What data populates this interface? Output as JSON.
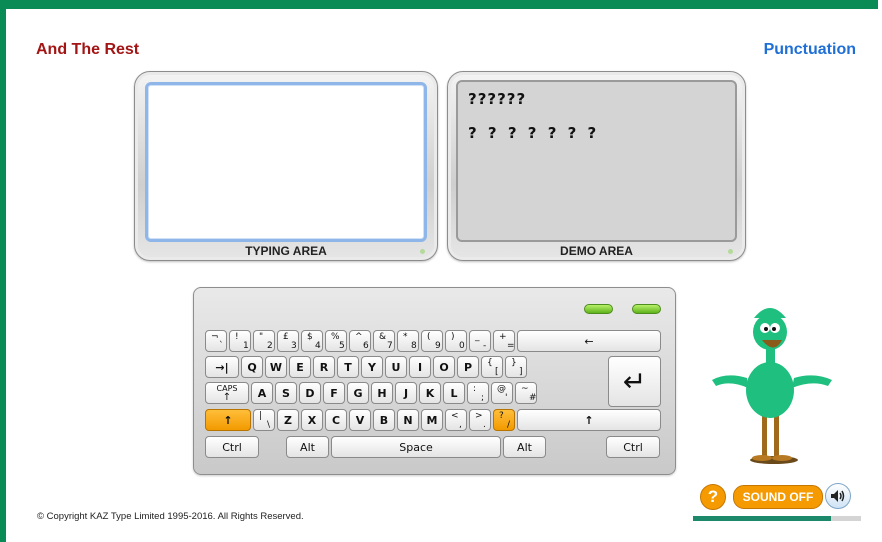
{
  "header": {
    "lesson_title": "And The Rest",
    "section_title": "Punctuation"
  },
  "typing_area": {
    "label": "TYPING AREA",
    "value": ""
  },
  "demo_area": {
    "label": "DEMO AREA",
    "line1": "??????",
    "line2": "? ? ? ? ? ? ?"
  },
  "keyboard": {
    "row1": [
      {
        "top": "¬",
        "bot": "`",
        "side": "¦"
      },
      {
        "top": "!",
        "bot": "1"
      },
      {
        "top": "\"",
        "bot": "2"
      },
      {
        "top": "£",
        "bot": "3"
      },
      {
        "top": "$",
        "bot": "4"
      },
      {
        "top": "%",
        "bot": "5"
      },
      {
        "top": "^",
        "bot": "6"
      },
      {
        "top": "&",
        "bot": "7"
      },
      {
        "top": "*",
        "bot": "8"
      },
      {
        "top": "(",
        "bot": "9"
      },
      {
        "top": ")",
        "bot": "0"
      },
      {
        "top": "_",
        "bot": "-"
      },
      {
        "top": "+",
        "bot": "="
      }
    ],
    "backspace": "←",
    "tab": "→|",
    "row2": [
      "Q",
      "W",
      "E",
      "R",
      "T",
      "Y",
      "U",
      "I",
      "O",
      "P"
    ],
    "row2_extra": [
      {
        "top": "{",
        "bot": "["
      },
      {
        "top": "}",
        "bot": "]"
      }
    ],
    "caps": "CAPS",
    "row3": [
      "A",
      "S",
      "D",
      "F",
      "G",
      "H",
      "J",
      "K",
      "L"
    ],
    "row3_extra": [
      {
        "top": ":",
        "bot": ";"
      },
      {
        "top": "@",
        "bot": "'"
      },
      {
        "top": "~",
        "bot": "#"
      }
    ],
    "enter": "↵",
    "shift": "↑",
    "row4_pre": {
      "top": "|",
      "bot": "\\"
    },
    "row4": [
      "Z",
      "X",
      "C",
      "V",
      "B",
      "N",
      "M"
    ],
    "row4_extra": [
      {
        "top": "<",
        "bot": ","
      },
      {
        "top": ">",
        "bot": "."
      },
      {
        "top": "?",
        "bot": "/"
      }
    ],
    "ctrl": "Ctrl",
    "alt": "Alt",
    "space": "Space",
    "highlight_color": "#f29a00"
  },
  "footer": {
    "copyright": "© Copyright KAZ Type Limited 1995-2016. All Rights Reserved.",
    "help": "?",
    "sound": "SOUND OFF",
    "progress": 0.82
  },
  "colors": {
    "frame": "#0a8a55",
    "lesson_title": "#a31515",
    "section_title": "#1f6fd6",
    "accent": "#f59a00"
  }
}
